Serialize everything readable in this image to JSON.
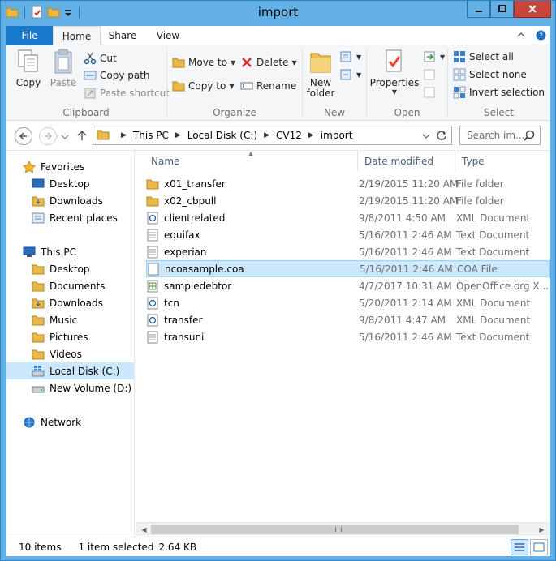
{
  "window": {
    "title": "import"
  },
  "tabs": {
    "file": "File",
    "home": "Home",
    "share": "Share",
    "view": "View"
  },
  "ribbon": {
    "clipboard": {
      "label": "Clipboard",
      "copy": "Copy",
      "paste": "Paste",
      "cut": "Cut",
      "copy_path": "Copy path",
      "paste_shortcut": "Paste shortcut"
    },
    "organize": {
      "label": "Organize",
      "move_to": "Move to",
      "copy_to": "Copy to",
      "delete": "Delete",
      "rename": "Rename"
    },
    "new": {
      "label": "New",
      "new_folder_line1": "New",
      "new_folder_line2": "folder"
    },
    "open": {
      "label": "Open",
      "properties": "Properties"
    },
    "select": {
      "label": "Select",
      "select_all": "Select all",
      "select_none": "Select none",
      "invert_selection": "Invert selection"
    }
  },
  "address": {
    "crumbs": [
      "This PC",
      "Local Disk (C:)",
      "CV12",
      "import"
    ],
    "search_placeholder": "Search im..."
  },
  "nav": {
    "favorites": "Favorites",
    "fav_items": [
      "Desktop",
      "Downloads",
      "Recent places"
    ],
    "this_pc": "This PC",
    "pc_items": [
      "Desktop",
      "Documents",
      "Downloads",
      "Music",
      "Pictures",
      "Videos",
      "Local Disk (C:)",
      "New Volume (D:)"
    ],
    "network": "Network"
  },
  "columns": {
    "name": "Name",
    "date": "Date modified",
    "type": "Type"
  },
  "files": [
    {
      "name": "x01_transfer",
      "date": "2/19/2015 11:20 AM",
      "type": "File folder",
      "icon": "folder-icon"
    },
    {
      "name": "x02_cbpull",
      "date": "2/19/2015 11:20 AM",
      "type": "File folder",
      "icon": "folder-icon"
    },
    {
      "name": "clientrelated",
      "date": "9/8/2011 4:50 AM",
      "type": "XML Document",
      "icon": "xml-file-icon"
    },
    {
      "name": "equifax",
      "date": "5/16/2011 2:46 AM",
      "type": "Text Document",
      "icon": "text-file-icon"
    },
    {
      "name": "experian",
      "date": "5/16/2011 2:46 AM",
      "type": "Text Document",
      "icon": "text-file-icon"
    },
    {
      "name": "ncoasample.coa",
      "date": "5/16/2011 2:46 AM",
      "type": "COA File",
      "icon": "blank-file-icon"
    },
    {
      "name": "sampledebtor",
      "date": "4/7/2017 10:31 AM",
      "type": "OpenOffice.org X...",
      "icon": "openoffice-file-icon"
    },
    {
      "name": "tcn",
      "date": "5/20/2011 2:14 AM",
      "type": "XML Document",
      "icon": "xml-file-icon"
    },
    {
      "name": "transfer",
      "date": "9/8/2011 4:47 AM",
      "type": "XML Document",
      "icon": "xml-file-icon"
    },
    {
      "name": "transuni",
      "date": "5/16/2011 2:46 AM",
      "type": "Text Document",
      "icon": "text-file-icon"
    }
  ],
  "status": {
    "items": "10 items",
    "selected": "1 item selected",
    "size": "2.64 KB"
  },
  "colors": {
    "accent": "#1979ca",
    "selection": "#cce8ff",
    "titlebar": "#62b0e6",
    "close": "#c7453b"
  }
}
